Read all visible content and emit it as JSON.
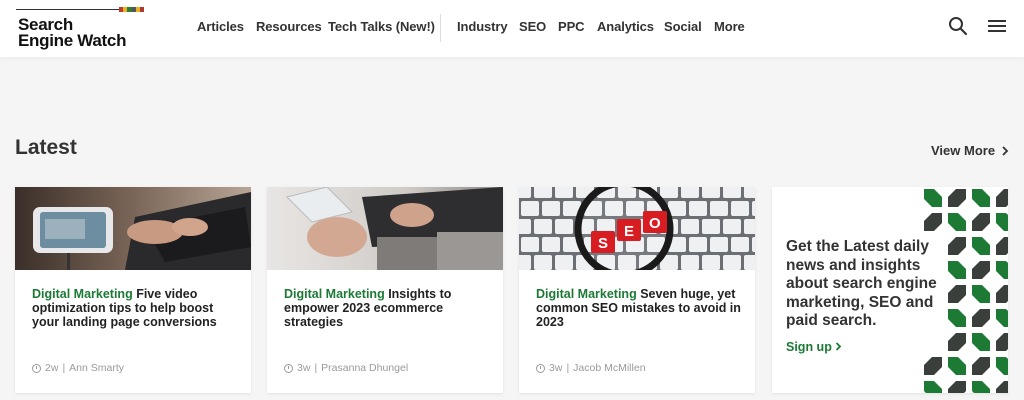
{
  "brand": {
    "logo_line1": "Search",
    "logo_line2": "Engine Watch",
    "bar_colors": [
      "#c0392b",
      "#e6b422",
      "#2e7d32",
      "#555555",
      "#e6b422",
      "#b03a2e"
    ]
  },
  "nav": {
    "primary": [
      "Articles",
      "Resources",
      "Tech Talks (New!)"
    ],
    "secondary": [
      "Industry",
      "SEO",
      "PPC",
      "Analytics",
      "Social",
      "More"
    ]
  },
  "header_icons": [
    "search-icon",
    "menu-icon"
  ],
  "latest": {
    "title": "Latest",
    "view_more": "View More",
    "cards": [
      {
        "category": "Digital Marketing",
        "title": "Five video optimization tips to help boost your landing page conversions",
        "age": "2w",
        "author": "Ann Smarty"
      },
      {
        "category": "Digital Marketing",
        "title": "Insights to empower 2023 ecommerce strategies",
        "age": "3w",
        "author": "Prasanna Dhungel"
      },
      {
        "category": "Digital Marketing",
        "title": "Seven huge, yet common SEO mistakes to avoid in 2023",
        "age": "3w",
        "author": "Jacob McMillen"
      }
    ]
  },
  "promo": {
    "text": "Get the Latest daily news and insights about search engine marketing, SEO and paid search.",
    "link": "Sign up",
    "colors": [
      "#1c7a35",
      "#3a3f3c"
    ]
  },
  "colors": {
    "accent": "#1c7a35",
    "text": "#333333",
    "muted": "#9a9a9a"
  }
}
